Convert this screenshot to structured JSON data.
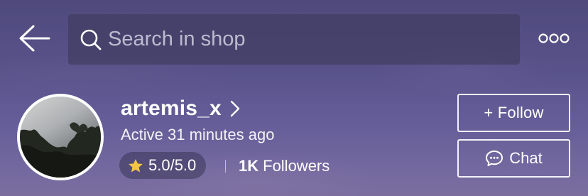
{
  "header": {
    "search": {
      "placeholder": "Search in shop",
      "value": ""
    },
    "icons": {
      "back": "arrow-left-icon",
      "search": "search-icon",
      "more": "more-horizontal-icon"
    }
  },
  "shop": {
    "name": "artemis_x",
    "active_status": "Active 31 minutes ago",
    "rating": "5.0/5.0",
    "followers_count": "1K",
    "followers_label": "Followers",
    "avatar_icon": "shop-avatar-image"
  },
  "actions": {
    "follow_label": "+ Follow",
    "chat_label": "Chat"
  },
  "colors": {
    "background_top": "#4f4a7c",
    "background_bottom": "#7b6e9f",
    "star": "#f5c542",
    "text": "#ffffff"
  }
}
